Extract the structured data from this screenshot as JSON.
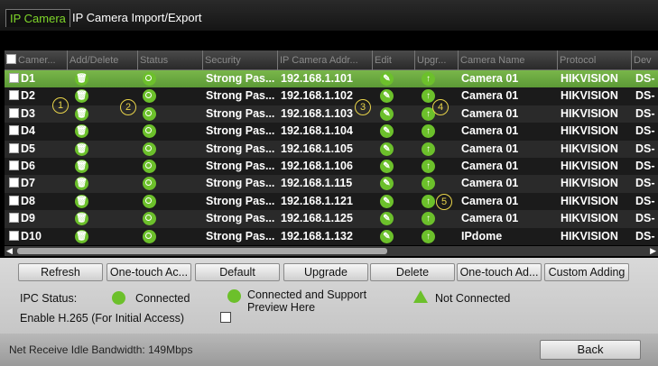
{
  "tabs": [
    "IP Camera",
    "IP Camera Import/Export"
  ],
  "columns": [
    "Camer...",
    "Add/Delete",
    "Status",
    "Security",
    "IP Camera Addr...",
    "Edit",
    "Upgr...",
    "Camera Name",
    "Protocol",
    "Dev"
  ],
  "rows": [
    {
      "id": "D1",
      "security": "Strong Pas...",
      "ip": "192.168.1.101",
      "name": "Camera 01",
      "protocol": "HIKVISION",
      "dev": "DS-"
    },
    {
      "id": "D2",
      "security": "Strong Pas...",
      "ip": "192.168.1.102",
      "name": "Camera 01",
      "protocol": "HIKVISION",
      "dev": "DS-"
    },
    {
      "id": "D3",
      "security": "Strong Pas...",
      "ip": "192.168.1.103",
      "name": "Camera 01",
      "protocol": "HIKVISION",
      "dev": "DS-"
    },
    {
      "id": "D4",
      "security": "Strong Pas...",
      "ip": "192.168.1.104",
      "name": "Camera 01",
      "protocol": "HIKVISION",
      "dev": "DS-"
    },
    {
      "id": "D5",
      "security": "Strong Pas...",
      "ip": "192.168.1.105",
      "name": "Camera 01",
      "protocol": "HIKVISION",
      "dev": "DS-"
    },
    {
      "id": "D6",
      "security": "Strong Pas...",
      "ip": "192.168.1.106",
      "name": "Camera 01",
      "protocol": "HIKVISION",
      "dev": "DS-"
    },
    {
      "id": "D7",
      "security": "Strong Pas...",
      "ip": "192.168.1.115",
      "name": "Camera 01",
      "protocol": "HIKVISION",
      "dev": "DS-"
    },
    {
      "id": "D8",
      "security": "Strong Pas...",
      "ip": "192.168.1.121",
      "name": "Camera 01",
      "protocol": "HIKVISION",
      "dev": "DS-"
    },
    {
      "id": "D9",
      "security": "Strong Pas...",
      "ip": "192.168.1.125",
      "name": "Camera 01",
      "protocol": "HIKVISION",
      "dev": "DS-"
    },
    {
      "id": "D10",
      "security": "Strong Pas...",
      "ip": "192.168.1.132",
      "name": "IPdome",
      "protocol": "HIKVISION",
      "dev": "DS-"
    }
  ],
  "callouts": [
    "1",
    "2",
    "3",
    "4",
    "5"
  ],
  "buttons": {
    "refresh": "Refresh",
    "one_touch_activate": "One-touch Ac...",
    "default": "Default",
    "upgrade": "Upgrade",
    "delete": "Delete",
    "one_touch_add": "One-touch Ad...",
    "custom_adding": "Custom Adding"
  },
  "legend": {
    "ipc_status": "IPC Status:",
    "connected": "Connected",
    "connected_preview": "Connected and Support Preview Here",
    "not_connected": "Not Connected",
    "enable_h265": "Enable H.265 (For Initial Access)"
  },
  "footer": {
    "bandwidth": "Net Receive Idle Bandwidth: 149Mbps",
    "back": "Back"
  },
  "colors": {
    "accent_green": "#6cc02b",
    "selected_row": "#6fab42",
    "callout": "#e8d44a"
  },
  "icons": {
    "delete": "trash-icon",
    "status": "connected-preview-icon",
    "edit": "edit-pencil-icon",
    "upgrade": "upgrade-arrow-icon"
  }
}
